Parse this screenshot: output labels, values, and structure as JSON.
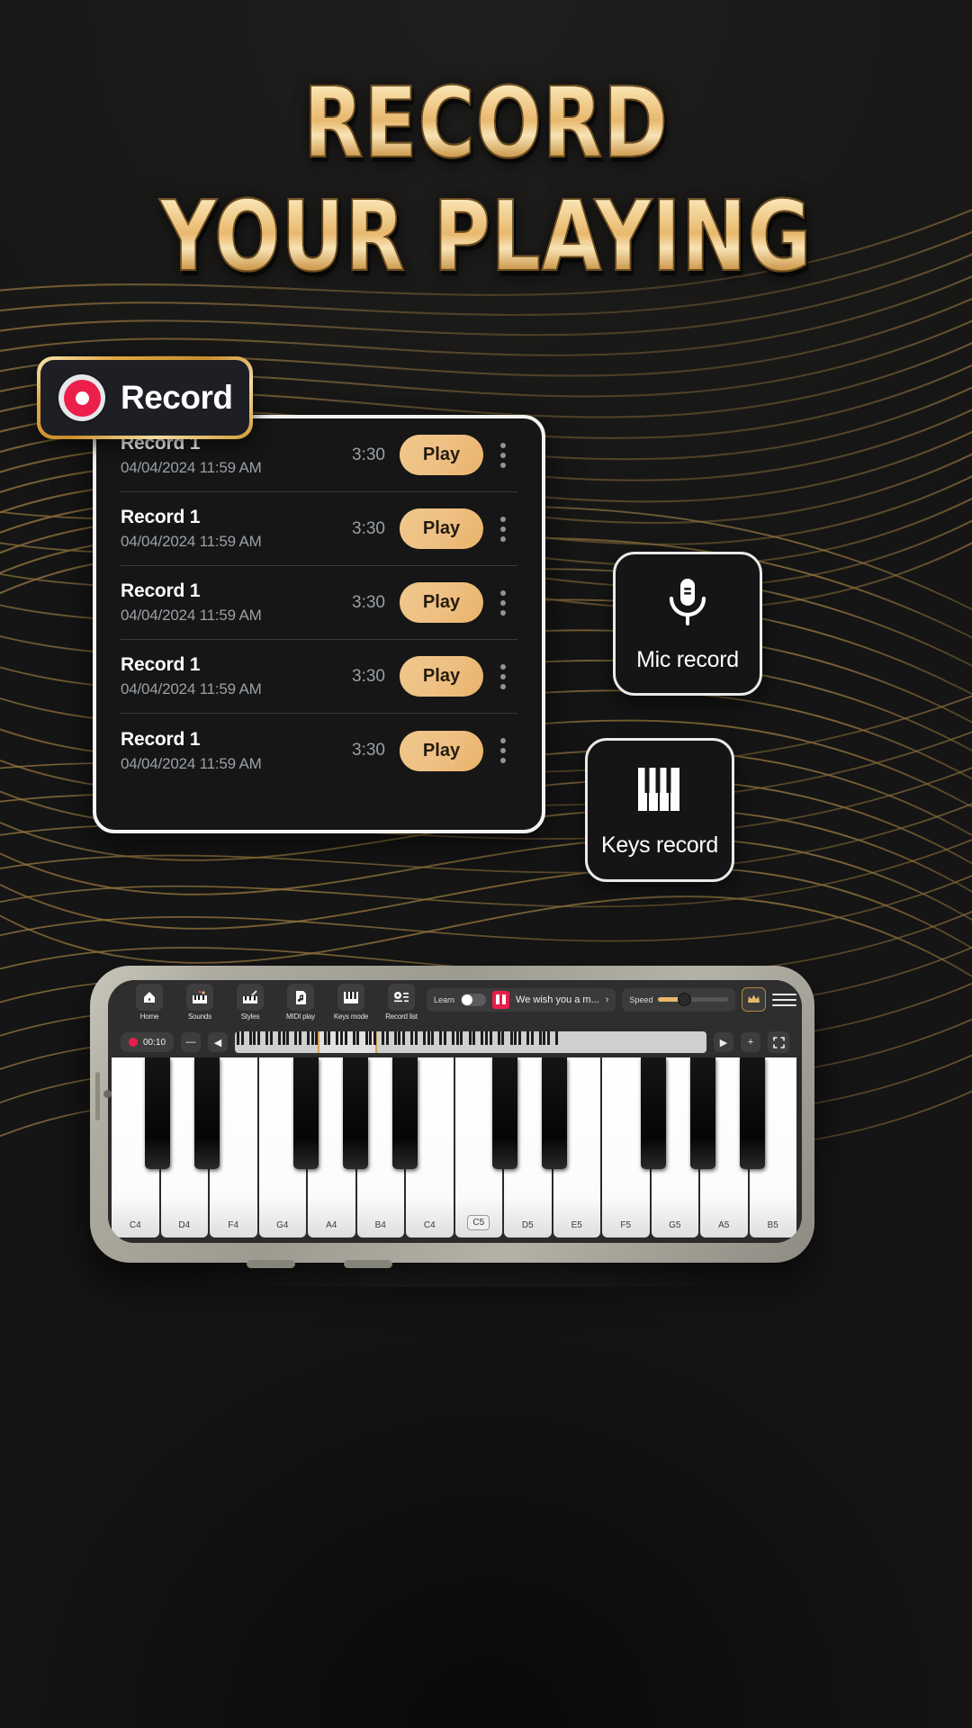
{
  "headline": {
    "line1": "RECORD",
    "line2": "YOUR PLAYING"
  },
  "record_badge": {
    "label": "Record",
    "icon": "record-dot-icon"
  },
  "record_list": {
    "columns": [
      "name",
      "datetime",
      "duration",
      "action",
      "menu"
    ],
    "rows": [
      {
        "name": "Record 1",
        "datetime": "04/04/2024  11:59 AM",
        "duration": "3:30",
        "action": "Play"
      },
      {
        "name": "Record 1",
        "datetime": "04/04/2024  11:59 AM",
        "duration": "3:30",
        "action": "Play"
      },
      {
        "name": "Record 1",
        "datetime": "04/04/2024  11:59 AM",
        "duration": "3:30",
        "action": "Play"
      },
      {
        "name": "Record 1",
        "datetime": "04/04/2024  11:59 AM",
        "duration": "3:30",
        "action": "Play"
      },
      {
        "name": "Record 1",
        "datetime": "04/04/2024  11:59 AM",
        "duration": "3:30",
        "action": "Play"
      }
    ]
  },
  "actions": [
    {
      "id": "mic",
      "label": "Mic record",
      "icon": "microphone-icon"
    },
    {
      "id": "keys",
      "label": "Keys record",
      "icon": "piano-keys-icon"
    }
  ],
  "tablet": {
    "toolbar": [
      {
        "label": "Home",
        "icon": "home-icon"
      },
      {
        "label": "Sounds",
        "icon": "sounds-icon"
      },
      {
        "label": "Styles",
        "icon": "styles-icon"
      },
      {
        "label": "MIDI play",
        "icon": "midi-file-icon"
      },
      {
        "label": "Keys mode",
        "icon": "keys-mode-icon"
      },
      {
        "label": "Record list",
        "icon": "record-list-icon"
      }
    ],
    "learn_label": "Learn",
    "song_title": "We wish you a m...",
    "song_chevron": "›",
    "speed_label": "Speed",
    "crown_icon": "crown-icon",
    "menu_icon": "hamburger-menu-icon",
    "pause_icon": "pause-icon",
    "timer": "00:10",
    "minus_label": "—",
    "prev_label": "◀",
    "next_label": "▶",
    "plus_label": "+",
    "fullscreen_icon": "fullscreen-icon",
    "white_key_labels": [
      "C4",
      "D4",
      "F4",
      "G4",
      "A4",
      "B4",
      "C4",
      "C5",
      "D5",
      "E5",
      "F5",
      "G5",
      "A5",
      "B5"
    ],
    "highlighted_key": "C5"
  },
  "colors": {
    "gold": "#e8b86d",
    "gold_light": "#f0c78b",
    "record_red": "#ec1f4b",
    "card_bg": "#161616",
    "page_bg": "#151515",
    "muted_text": "#9aa0a6"
  }
}
